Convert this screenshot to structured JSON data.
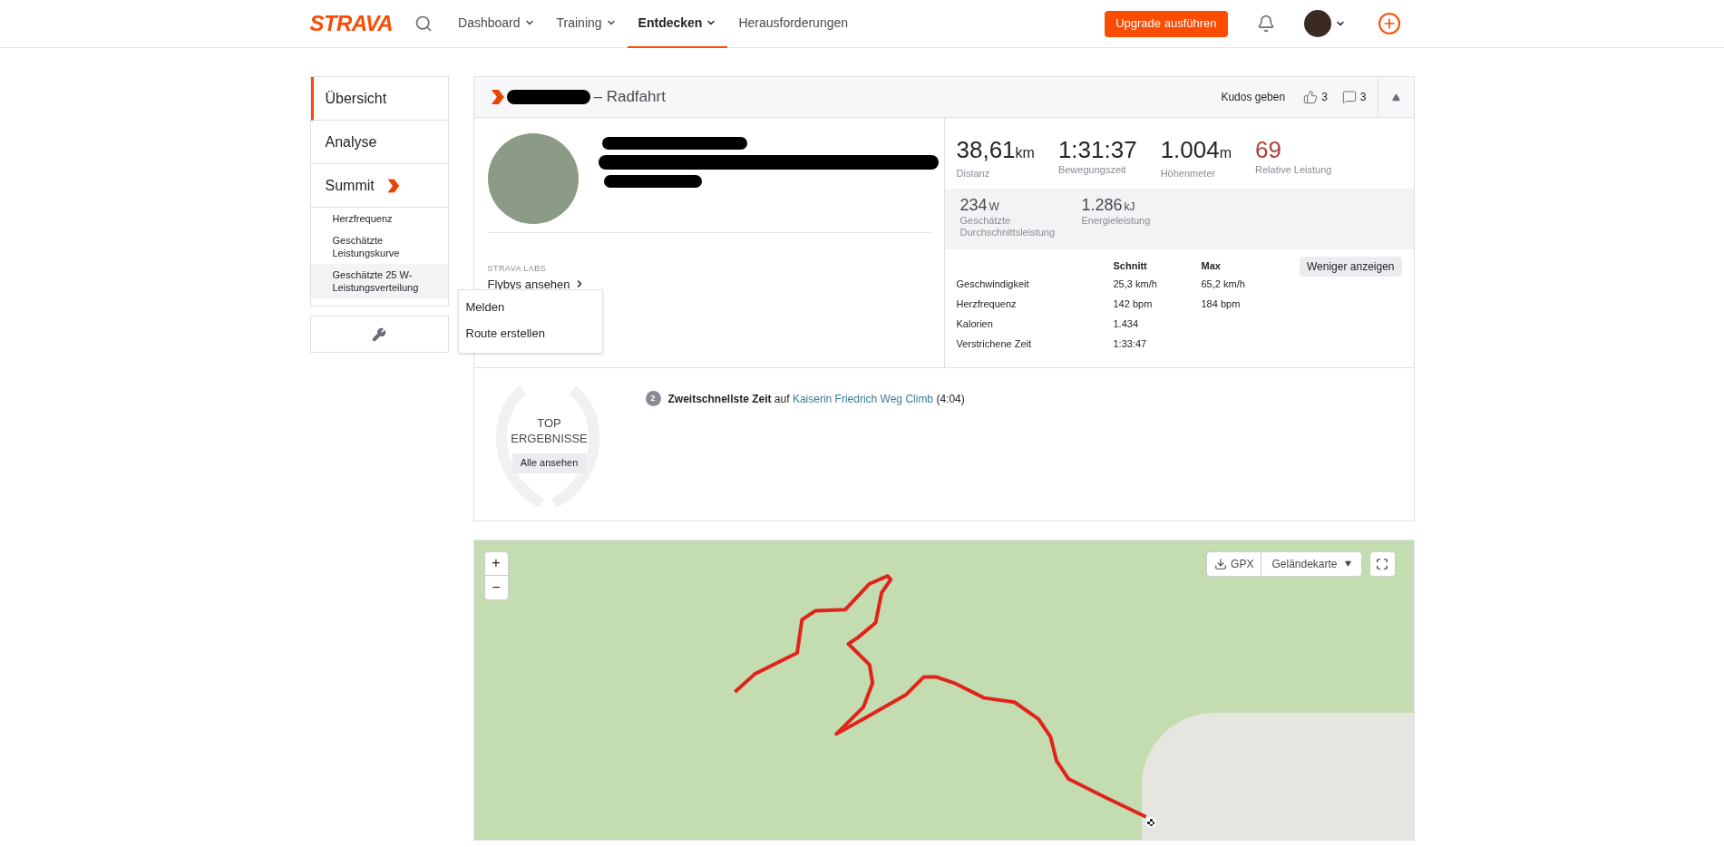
{
  "nav": {
    "logo": "STRAVA",
    "items": [
      {
        "label": "Dashboard",
        "caret": true,
        "selected": false
      },
      {
        "label": "Training",
        "caret": true,
        "selected": false
      },
      {
        "label": "Entdecken",
        "caret": true,
        "selected": true
      },
      {
        "label": "Herausforderungen",
        "caret": false,
        "selected": false
      }
    ],
    "upgrade": "Upgrade ausführen"
  },
  "sidebar": {
    "items": [
      {
        "label": "Übersicht",
        "selected": true
      },
      {
        "label": "Analyse",
        "selected": false
      },
      {
        "label": "Summit",
        "selected": false
      }
    ],
    "subitems": [
      {
        "label": "Herzfrequenz",
        "selected": false
      },
      {
        "label": "Geschätzte Leistungskurve",
        "selected": false
      },
      {
        "label": "Geschätzte 25 W-Leistungsverteilung",
        "selected": true
      }
    ]
  },
  "menu": [
    "Melden",
    "Route erstellen"
  ],
  "activity": {
    "title": "– Radfahrt",
    "kudos_label": "Kudos geben",
    "kudos_count": "3",
    "comment_count": "3",
    "labs_caption": "STRAVA LABS",
    "labs_link": "Flybys ansehen",
    "stats": [
      {
        "value": "38,61",
        "unit": "km",
        "label": "Distanz",
        "highlight": false
      },
      {
        "value": "1:31:37",
        "label": "Bewegungszeit",
        "highlight": false
      },
      {
        "value": "1.004",
        "unit": "m",
        "label": "Höhenmeter",
        "highlight": false
      },
      {
        "value": "69",
        "label": "Relative Leistung",
        "highlight": true
      }
    ],
    "secondary_stats": [
      {
        "value": "234",
        "unit": "W",
        "label": "Geschätzte Durchschnittsleistung"
      },
      {
        "value": "1.286",
        "unit": "kJ",
        "label": "Energieleistung"
      }
    ],
    "table": {
      "columns": [
        "Schnitt",
        "Max"
      ],
      "rows": [
        {
          "label": "Geschwindigkeit",
          "avg": "25,3 km/h",
          "max": "65,2 km/h"
        },
        {
          "label": "Herzfrequenz",
          "avg": "142 bpm",
          "max": "184 bpm"
        },
        {
          "label": "Kalorien",
          "avg": "1.434"
        },
        {
          "label": "Verstrichene Zeit",
          "avg": "1:33:47"
        }
      ]
    },
    "less_button": "Weniger anzeigen"
  },
  "top_results": {
    "title_top": "TOP",
    "title_bottom": "ERGEBNISSE",
    "button": "Alle ansehen",
    "achievements": [
      {
        "rank": "2",
        "text": "**Zweitschnellste Zeit** auf",
        "segment": "Kaiserin Friedrich Weg Climb",
        "time": "(4:04)"
      }
    ]
  },
  "map": {
    "zoom_in": "+",
    "zoom_out": "−",
    "gpx": "GPX",
    "layer": "Geländekarte"
  }
}
